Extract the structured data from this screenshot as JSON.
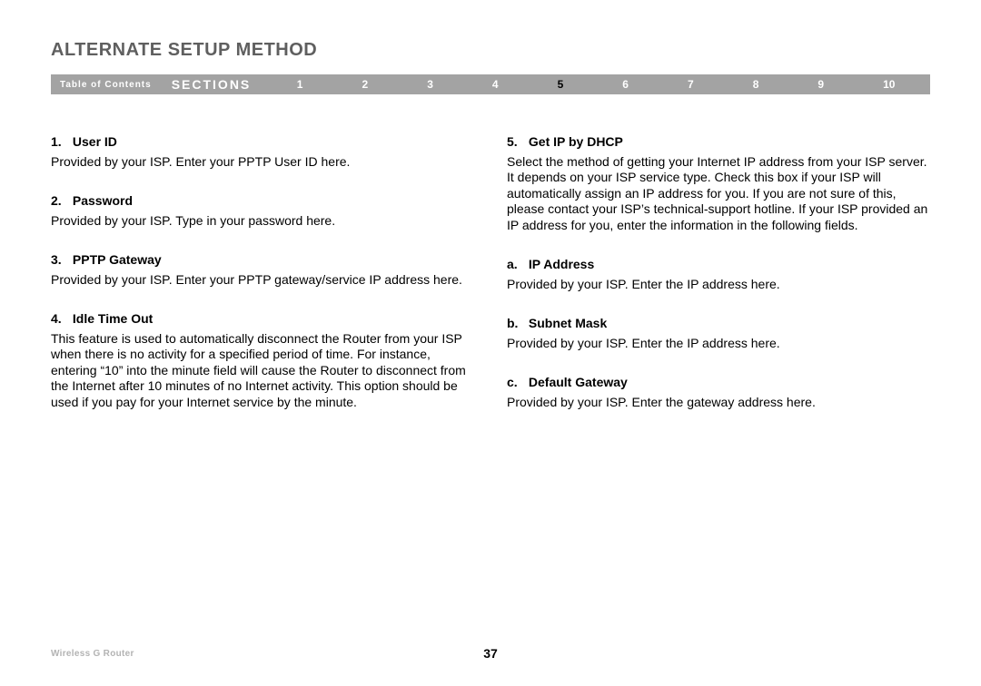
{
  "header": {
    "title": "ALTERNATE SETUP METHOD"
  },
  "nav": {
    "toc_label": "Table of Contents",
    "sections_label": "SECTIONS",
    "numbers": [
      "1",
      "2",
      "3",
      "4",
      "5",
      "6",
      "7",
      "8",
      "9",
      "10"
    ],
    "current": "5"
  },
  "left_column": {
    "items": [
      {
        "num": "1.",
        "title": "User ID",
        "body": "Provided by your ISP. Enter your PPTP User ID here."
      },
      {
        "num": "2.",
        "title": "Password",
        "body": "Provided by your ISP. Type in your password here."
      },
      {
        "num": "3.",
        "title": "PPTP Gateway",
        "body": "Provided by your ISP. Enter your PPTP gateway/service IP address here."
      },
      {
        "num": "4.",
        "title": "Idle Time Out",
        "body": "This feature is used to automatically disconnect the Router from your ISP when there is no activity for a specified period of time. For instance, entering “10” into the minute field will cause the Router to disconnect from the Internet after 10 minutes of no Internet activity. This option should be used if you pay for your Internet service by the minute."
      }
    ]
  },
  "right_column": {
    "items": [
      {
        "num": "5.",
        "title": "Get IP by DHCP",
        "body": "Select the method of getting your Internet IP address from your ISP server. It depends on your ISP service type. Check this box if your ISP will automatically assign an IP address for you. If you are not sure of this, please contact your ISP’s technical-support hotline. If your ISP provided an IP address for you, enter the information in the following fields."
      },
      {
        "num": "a.",
        "title": "IP Address",
        "body": "Provided by your ISP. Enter the IP address here."
      },
      {
        "num": "b.",
        "title": "Subnet Mask",
        "body": "Provided by your ISP. Enter the IP address here."
      },
      {
        "num": "c.",
        "title": "Default Gateway",
        "body": "Provided by your ISP. Enter the gateway address here."
      }
    ]
  },
  "footer": {
    "product": "Wireless G Router",
    "page_number": "37"
  }
}
